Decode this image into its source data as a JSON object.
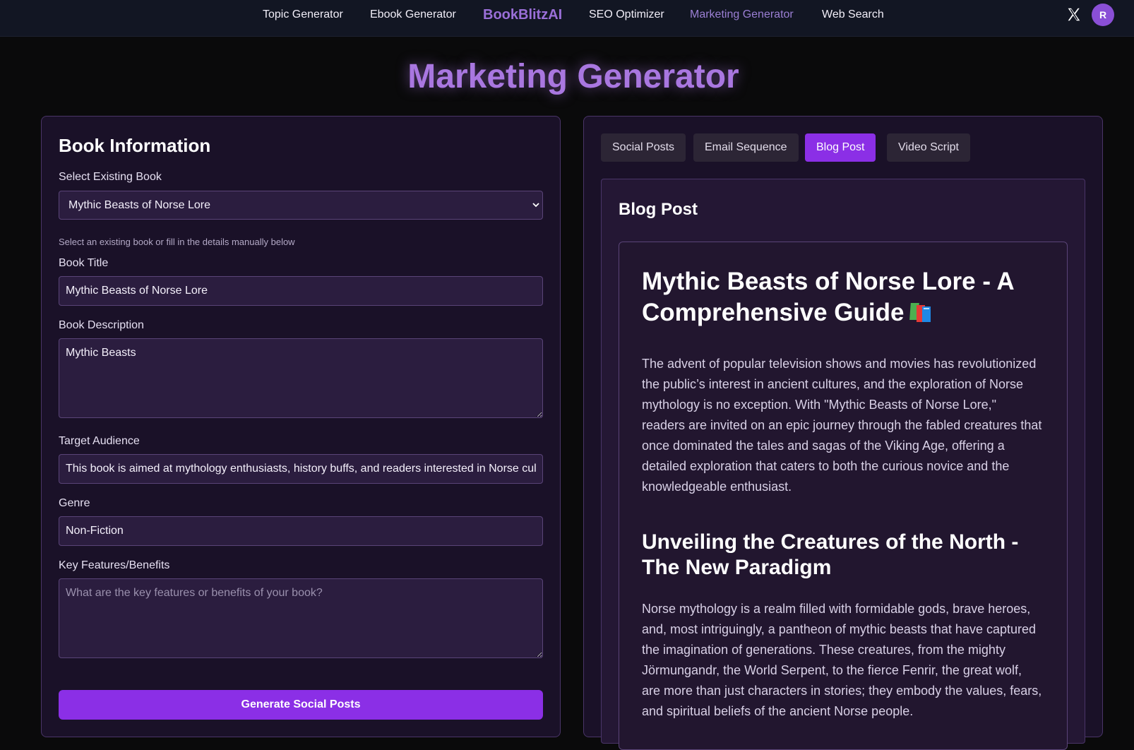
{
  "nav": {
    "items": [
      {
        "label": "Topic Generator",
        "active": false
      },
      {
        "label": "Ebook Generator",
        "active": false
      },
      {
        "label": "SEO Optimizer",
        "active": false
      },
      {
        "label": "Marketing Generator",
        "active": true
      },
      {
        "label": "Web Search",
        "active": false
      }
    ],
    "brand": "BookBlitzAI",
    "social_icon": "x-logo-icon",
    "avatar_initial": "R"
  },
  "page": {
    "title": "Marketing Generator"
  },
  "book_info": {
    "heading": "Book Information",
    "select_label": "Select Existing Book",
    "selected_book": "Mythic Beasts of Norse Lore",
    "help_text": "Select an existing book or fill in the details manually below",
    "title_label": "Book Title",
    "title_value": "Mythic Beasts of Norse Lore",
    "description_label": "Book Description",
    "description_value": "Mythic Beasts",
    "audience_label": "Target Audience",
    "audience_value": "This book is aimed at mythology enthusiasts, history buffs, and readers interested in Norse cult",
    "genre_label": "Genre",
    "genre_value": "Non-Fiction",
    "features_label": "Key Features/Benefits",
    "features_placeholder": "What are the key features or benefits of your book?",
    "generate_button": "Generate Social Posts"
  },
  "tabs": [
    {
      "label": "Social Posts",
      "active": false
    },
    {
      "label": "Email Sequence",
      "active": false
    },
    {
      "label": "Blog Post",
      "active": true
    },
    {
      "label": "Video Script",
      "active": false
    }
  ],
  "output": {
    "title": "Blog Post",
    "h1": "Mythic Beasts of Norse Lore - A Comprehensive Guide",
    "p1": "The advent of popular television shows and movies has revolutionized the public’s interest in ancient cultures, and the exploration of Norse mythology is no exception. With \"Mythic Beasts of Norse Lore,\" readers are invited on an epic journey through the fabled creatures that once dominated the tales and sagas of the Viking Age, offering a detailed exploration that caters to both the curious novice and the knowledgeable enthusiast.",
    "h2": "Unveiling the Creatures of the North - The New Paradigm",
    "p2": "Norse mythology is a realm filled with formidable gods, brave heroes, and, most intriguingly, a pantheon of mythic beasts that have captured the imagination of generations. These creatures, from the mighty Jörmungandr, the World Serpent, to the fierce Fenrir, the great wolf, are more than just characters in stories; they embody the values, fears, and spiritual beliefs of the ancient Norse people."
  },
  "colors": {
    "accent": "#8b2fe6",
    "brand": "#9a6fd8",
    "panel_bg": "#1a1128"
  }
}
